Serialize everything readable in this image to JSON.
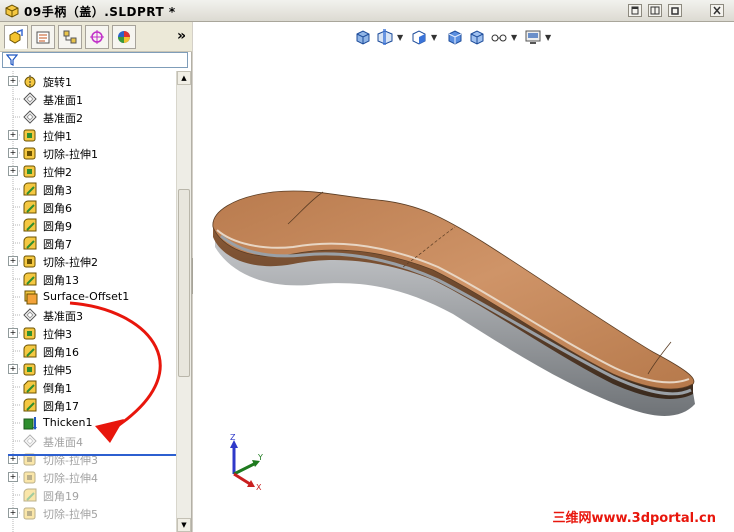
{
  "window": {
    "title": "09手柄（盖）.SLDPRT *"
  },
  "panel": {
    "tabs": [
      "featuremanager-icon",
      "propertymanager-icon",
      "configurationmanager-icon",
      "dimxpert-icon",
      "appearance-icon"
    ],
    "more_label": "»"
  },
  "tree": {
    "items": [
      {
        "label": "旋转1",
        "icon": "revolve-icon",
        "expander": true
      },
      {
        "label": "基准面1",
        "icon": "plane-icon",
        "expander": false
      },
      {
        "label": "基准面2",
        "icon": "plane-icon",
        "expander": false
      },
      {
        "label": "拉伸1",
        "icon": "extrude-icon",
        "expander": true
      },
      {
        "label": "切除-拉伸1",
        "icon": "cut-extrude-icon",
        "expander": true
      },
      {
        "label": "拉伸2",
        "icon": "extrude-icon",
        "expander": true
      },
      {
        "label": "圆角3",
        "icon": "fillet-icon",
        "expander": false
      },
      {
        "label": "圆角6",
        "icon": "fillet-icon",
        "expander": false
      },
      {
        "label": "圆角9",
        "icon": "fillet-icon",
        "expander": false
      },
      {
        "label": "圆角7",
        "icon": "fillet-icon",
        "expander": false
      },
      {
        "label": "切除-拉伸2",
        "icon": "cut-extrude-icon",
        "expander": true
      },
      {
        "label": "圆角13",
        "icon": "fillet-icon",
        "expander": false
      },
      {
        "label": "Surface-Offset1",
        "icon": "surface-offset-icon",
        "expander": false
      },
      {
        "label": "基准面3",
        "icon": "plane-icon",
        "expander": false
      },
      {
        "label": "拉伸3",
        "icon": "extrude-icon",
        "expander": true
      },
      {
        "label": "圆角16",
        "icon": "fillet-icon",
        "expander": false
      },
      {
        "label": "拉伸5",
        "icon": "extrude-icon",
        "expander": true
      },
      {
        "label": "倒角1",
        "icon": "chamfer-icon",
        "expander": false
      },
      {
        "label": "圆角17",
        "icon": "fillet-icon",
        "expander": false
      },
      {
        "label": "Thicken1",
        "icon": "thicken-icon",
        "expander": false
      },
      {
        "label": "基准面4",
        "icon": "plane-icon",
        "expander": false,
        "suppressed": true
      },
      {
        "label": "切除-拉伸3",
        "icon": "cut-extrude-icon",
        "expander": true,
        "suppressed": true
      },
      {
        "label": "切除-拉伸4",
        "icon": "cut-extrude-icon",
        "expander": true,
        "suppressed": true
      },
      {
        "label": "圆角19",
        "icon": "fillet-icon",
        "expander": false,
        "suppressed": true
      },
      {
        "label": "切除-拉伸5",
        "icon": "cut-extrude-icon",
        "expander": true,
        "suppressed": true
      }
    ]
  },
  "triad": {
    "z": "Z",
    "y": "Y",
    "x": "X"
  },
  "watermark": "三维网www.3dportal.cn",
  "colors": {
    "accent_red": "#e8160c",
    "rollback_bar": "#2c5fd0",
    "part_copper": "#c98a5a"
  }
}
